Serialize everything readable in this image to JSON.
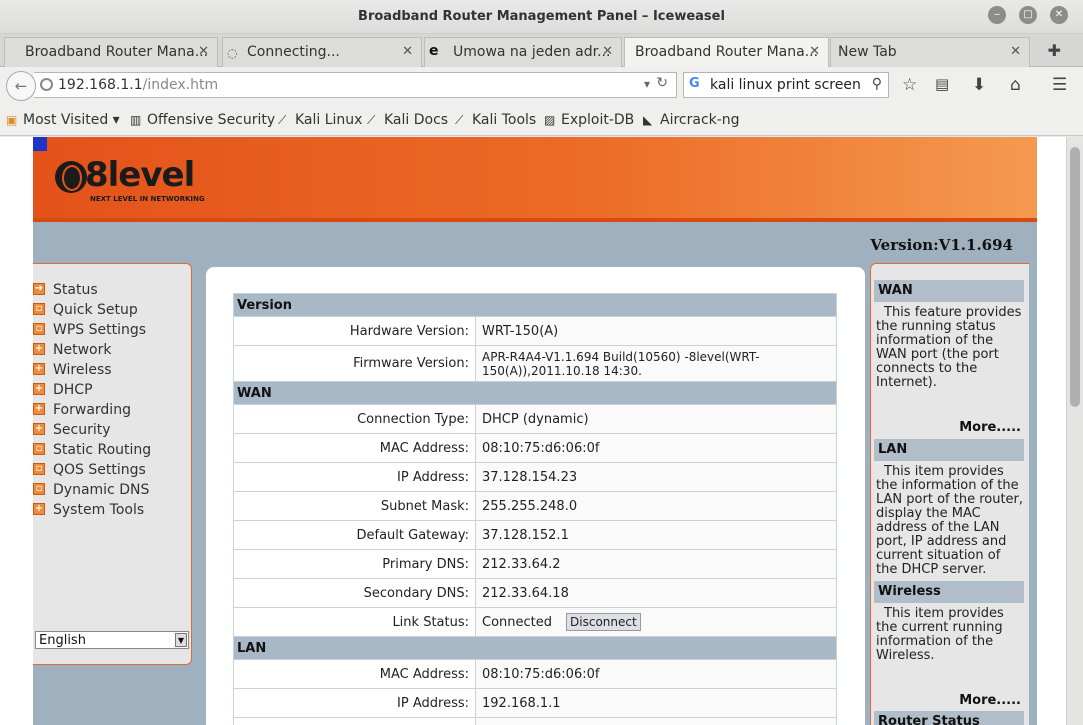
{
  "window": {
    "title": "Broadband Router Management Panel – Iceweasel"
  },
  "tabs": [
    {
      "label": "Broadband Router Mana...",
      "close": "✕"
    },
    {
      "label": "Connecting...",
      "close": "✕"
    },
    {
      "label": "Umowa na jeden adr...",
      "close": "✕"
    },
    {
      "label": "Broadband Router Mana...",
      "close": "✕"
    },
    {
      "label": "New Tab",
      "close": "✕"
    }
  ],
  "nav": {
    "url_host": "192.168.1.1",
    "url_path": "/index.htm",
    "search": "kali linux print screen"
  },
  "bookmarks": [
    "Most Visited",
    "Offensive Security",
    "Kali Linux",
    "Kali Docs",
    "Kali Tools",
    "Exploit-DB",
    "Aircrack-ng"
  ],
  "router": {
    "logo_name": "8level",
    "logo_tag": "NEXT LEVEL IN NETWORKING",
    "version": "Version:V1.1.694",
    "menu": [
      "Status",
      "Quick Setup",
      "WPS Settings",
      "Network",
      "Wireless",
      "DHCP",
      "Forwarding",
      "Security",
      "Static Routing",
      "QOS Settings",
      "Dynamic DNS",
      "System Tools"
    ],
    "language": "English"
  },
  "status": {
    "version_header": "Version",
    "hardware_label": "Hardware Version:",
    "hardware_value": "WRT-150(A)",
    "firmware_label": "Firmware Version:",
    "firmware_value": "APR-R4A4-V1.1.694 Build(10560) -8level(WRT-150(A)),2011.10.18 14:30.",
    "wan_header": "WAN",
    "conn_label": "Connection Type:",
    "conn_value": "DHCP (dynamic)",
    "wan_mac_label": "MAC Address:",
    "wan_mac_value": "08:10:75:d6:06:0f",
    "ip_label": "IP Address:",
    "ip_value": "37.128.154.23",
    "mask_label": "Subnet Mask:",
    "mask_value": "255.255.248.0",
    "gw_label": "Default Gateway:",
    "gw_value": "37.128.152.1",
    "dns1_label": "Primary DNS:",
    "dns1_value": "212.33.64.2",
    "dns2_label": "Secondary DNS:",
    "dns2_value": "212.33.64.18",
    "link_label": "Link Status:",
    "link_value": "Connected",
    "disconnect": "Disconnect",
    "lan_header": "LAN",
    "lan_mac_label": "MAC Address:",
    "lan_mac_value": "08:10:75:d6:06:0f",
    "lan_ip_label": "IP Address:",
    "lan_ip_value": "192.168.1.1"
  },
  "help": {
    "wan_title": "WAN",
    "wan_text": "This feature provides the running status information of the WAN port (the port connects to the Internet).",
    "more1": "More.....",
    "lan_title": "LAN",
    "lan_text": "This item provides the information of the LAN port of the router, display the MAC address of the LAN port, IP address and current situation of the DHCP server.",
    "wireless_title": "Wireless",
    "wireless_text": "This item provides the current running information of the Wireless.",
    "more2": "More.....",
    "router_status_title": "Router Status"
  }
}
